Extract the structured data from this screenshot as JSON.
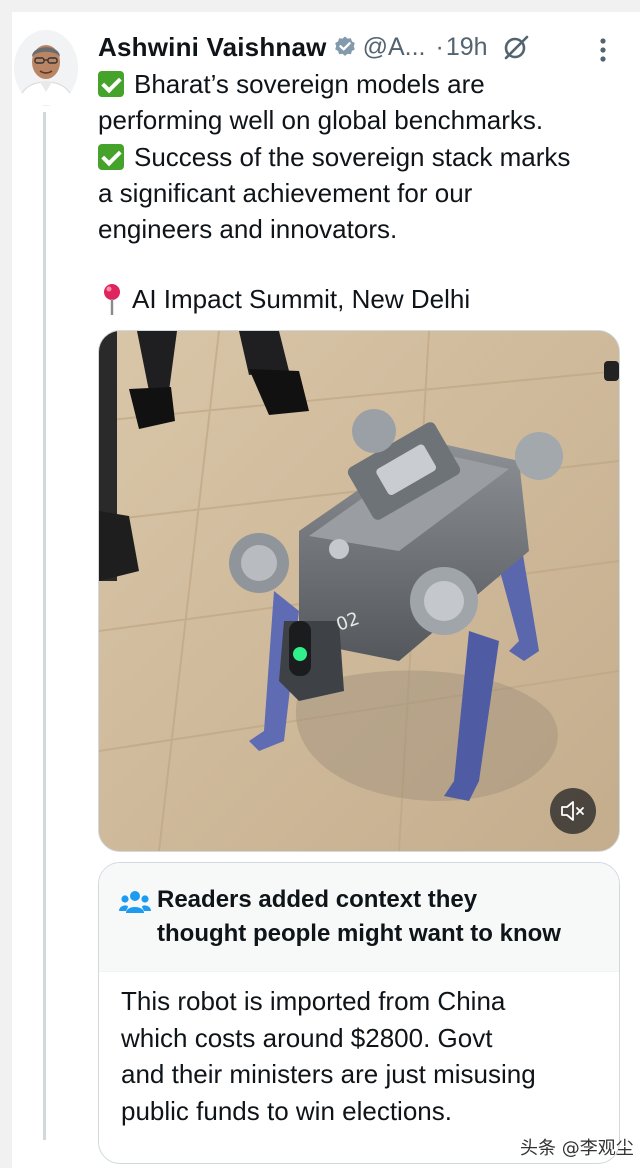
{
  "post": {
    "author_name": "Ashwini Vaishnaw",
    "handle": "@A...",
    "separator": "·",
    "time": "19h",
    "body_lines": [
      {
        "emoji": "check-mark-icon",
        "text": "Bharat’s sovereign models are"
      },
      {
        "emoji": null,
        "text": "performing well on global benchmarks."
      },
      {
        "emoji": "check-mark-icon",
        "text": "Success of the sovereign stack marks"
      },
      {
        "emoji": null,
        "text": "a significant achievement for our"
      },
      {
        "emoji": null,
        "text": "engineers and innovators."
      }
    ],
    "location_text": "AI Impact Summit, New Delhi",
    "icons": {
      "verified": "verified-badge-icon",
      "grok": "grok-icon",
      "more": "more-options-icon",
      "pin": "location-pin-icon",
      "mute": "muted-speaker-icon"
    }
  },
  "community_note": {
    "title_line1": "Readers added context they",
    "title_line2": "thought people might want to know",
    "text_lines": [
      "This robot is imported from China",
      "which costs around $2800. Govt",
      "and their ministers are just misusing",
      "public funds to win elections."
    ],
    "icon": "people-icon"
  },
  "watermark": "头条 @李观尘",
  "colors": {
    "text": "#0f1419",
    "secondary_text": "#536471",
    "check_green": "#45a22a",
    "verified_gray": "#829aab",
    "note_icon_blue": "#1d9bf0",
    "border": "#cfd9de"
  }
}
